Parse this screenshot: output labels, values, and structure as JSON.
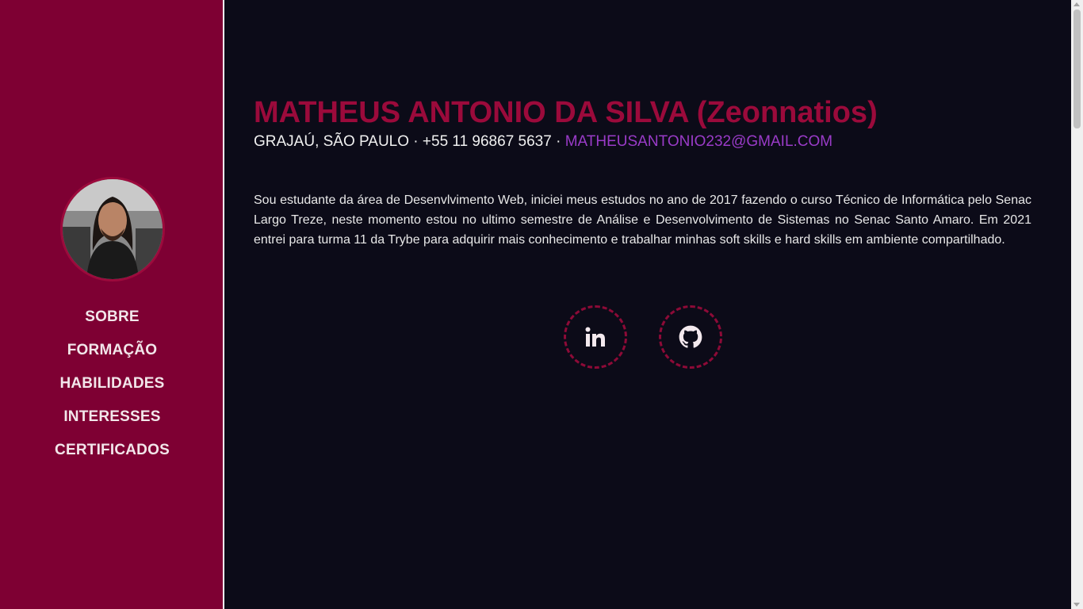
{
  "sidebar": {
    "avatar_alt": "Profile photo",
    "nav": [
      {
        "label": "SOBRE"
      },
      {
        "label": "FORMAÇÃO"
      },
      {
        "label": "HABILIDADES"
      },
      {
        "label": "INTERESSES"
      },
      {
        "label": "CERTIFICADOS"
      }
    ]
  },
  "main": {
    "name": "MATHEUS ANTONIO DA SILVA (Zeonnatios)",
    "contact": {
      "location_phone": "GRAJAÚ, SÃO PAULO · +55 11 96867 5637 · ",
      "email": "MATHEUSANTONIO232@GMAIL.COM"
    },
    "about": "Sou estudante da área de Desenvlvimento Web, iniciei meus estudos no ano de 2017 fazendo o curso Técnico de Informática pelo Senac Largo Treze, neste momento estou no ultimo semestre de Análise e Desenvolvimento de Sistemas no Senac Santo Amaro. Em 2021 entrei para turma 11 da Trybe para adquirir mais conhecimento e trabalhar minhas soft skills e hard skills em ambiente compartilhado.",
    "social": [
      {
        "icon": "linkedin-icon"
      },
      {
        "icon": "github-icon"
      }
    ]
  },
  "colors": {
    "sidebar_bg": "#7e0033",
    "page_bg": "#0c0b18",
    "accent": "#9b0a3b",
    "email_link": "#9a3bc8"
  }
}
